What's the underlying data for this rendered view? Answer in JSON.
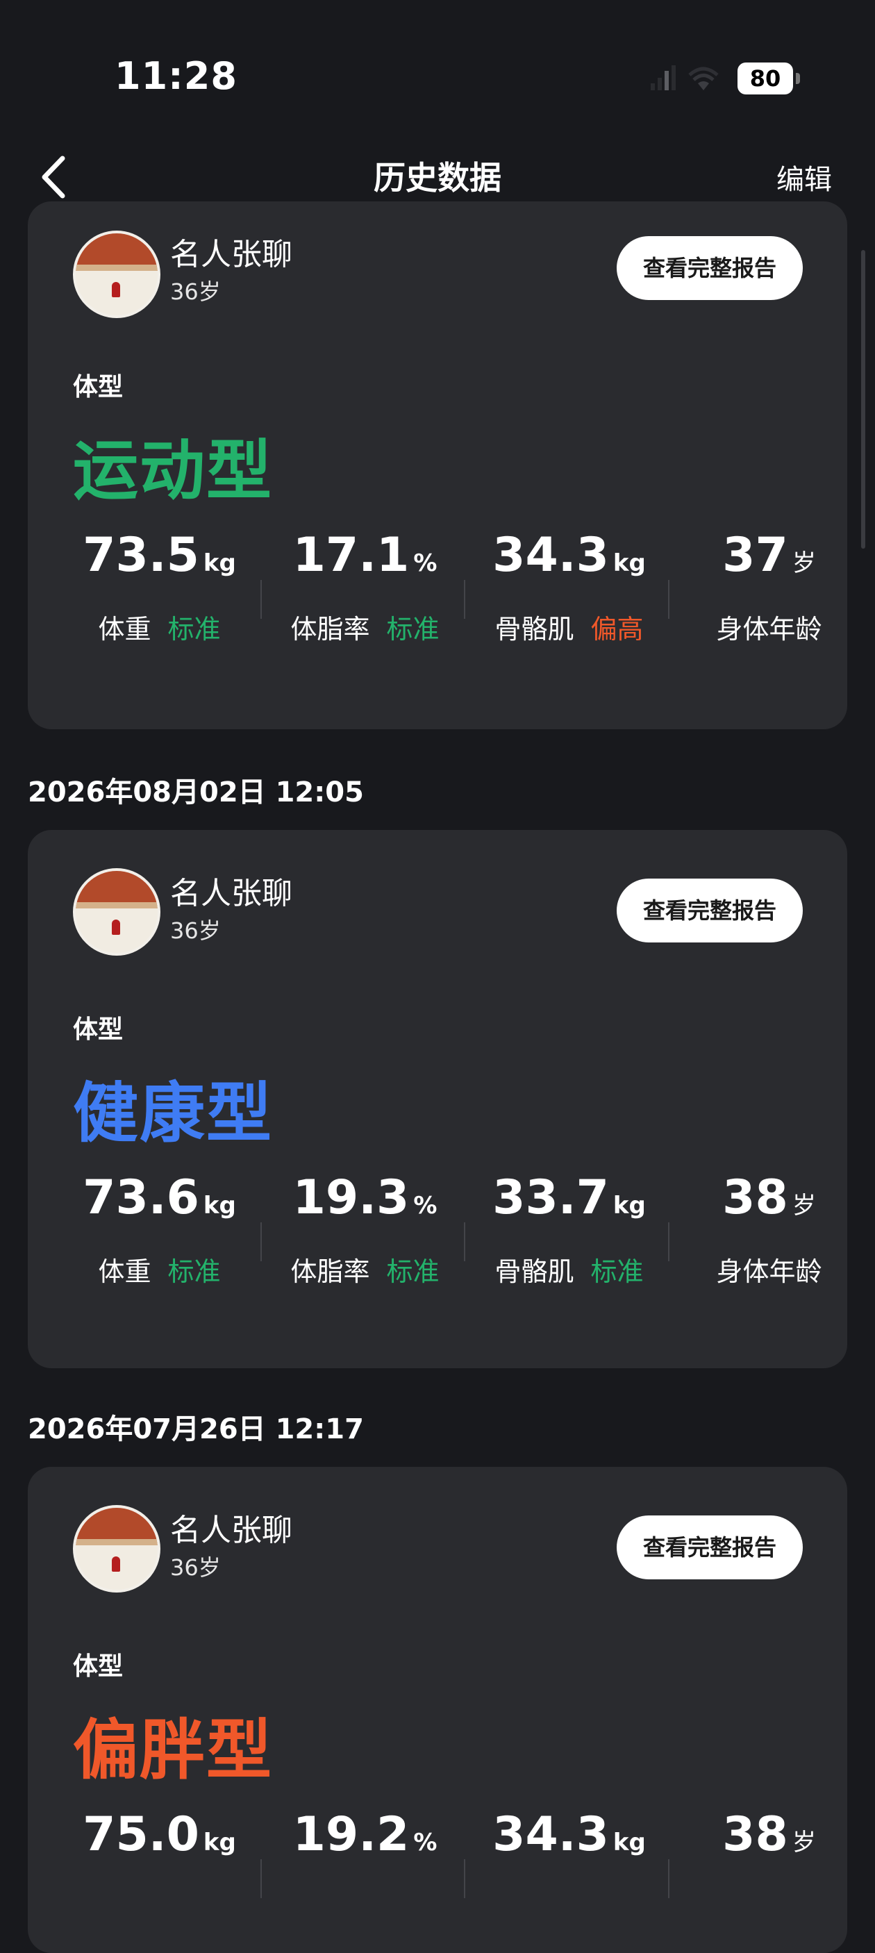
{
  "status_bar": {
    "time": "11:28",
    "battery": "80"
  },
  "nav": {
    "title": "历史数据",
    "edit": "编辑"
  },
  "colors": {
    "green": "#23b26b",
    "blue": "#3f7cf4",
    "orange": "#f0582a",
    "card": "#2a2b2f",
    "background": "#18191d"
  },
  "records": [
    {
      "date": "",
      "user": {
        "name": "名人张聊",
        "age": "36岁"
      },
      "report_button": "查看完整报告",
      "body_type_label": "体型",
      "body_type": "运动型",
      "body_type_color": "#23b26b",
      "metrics": [
        {
          "value": "73.5",
          "unit": "kg",
          "label": "体重",
          "status": "标准",
          "status_color": "#23b26b"
        },
        {
          "value": "17.1",
          "unit": "%",
          "label": "体脂率",
          "status": "标准",
          "status_color": "#23b26b"
        },
        {
          "value": "34.3",
          "unit": "kg",
          "label": "骨骼肌",
          "status": "偏高",
          "status_color": "#f0582a"
        },
        {
          "value": "37",
          "unit": "岁",
          "label": "身体年龄",
          "status": "",
          "status_color": ""
        }
      ]
    },
    {
      "date": "2026年08月02日 12:05",
      "user": {
        "name": "名人张聊",
        "age": "36岁"
      },
      "report_button": "查看完整报告",
      "body_type_label": "体型",
      "body_type": "健康型",
      "body_type_color": "#3f7cf4",
      "metrics": [
        {
          "value": "73.6",
          "unit": "kg",
          "label": "体重",
          "status": "标准",
          "status_color": "#23b26b"
        },
        {
          "value": "19.3",
          "unit": "%",
          "label": "体脂率",
          "status": "标准",
          "status_color": "#23b26b"
        },
        {
          "value": "33.7",
          "unit": "kg",
          "label": "骨骼肌",
          "status": "标准",
          "status_color": "#23b26b"
        },
        {
          "value": "38",
          "unit": "岁",
          "label": "身体年龄",
          "status": "",
          "status_color": ""
        }
      ]
    },
    {
      "date": "2026年07月26日 12:17",
      "user": {
        "name": "名人张聊",
        "age": "36岁"
      },
      "report_button": "查看完整报告",
      "body_type_label": "体型",
      "body_type": "偏胖型",
      "body_type_color": "#f0582a",
      "metrics": [
        {
          "value": "75.0",
          "unit": "kg",
          "label": "",
          "status": "",
          "status_color": ""
        },
        {
          "value": "19.2",
          "unit": "%",
          "label": "",
          "status": "",
          "status_color": ""
        },
        {
          "value": "34.3",
          "unit": "kg",
          "label": "",
          "status": "",
          "status_color": ""
        },
        {
          "value": "38",
          "unit": "岁",
          "label": "",
          "status": "",
          "status_color": ""
        }
      ]
    }
  ]
}
